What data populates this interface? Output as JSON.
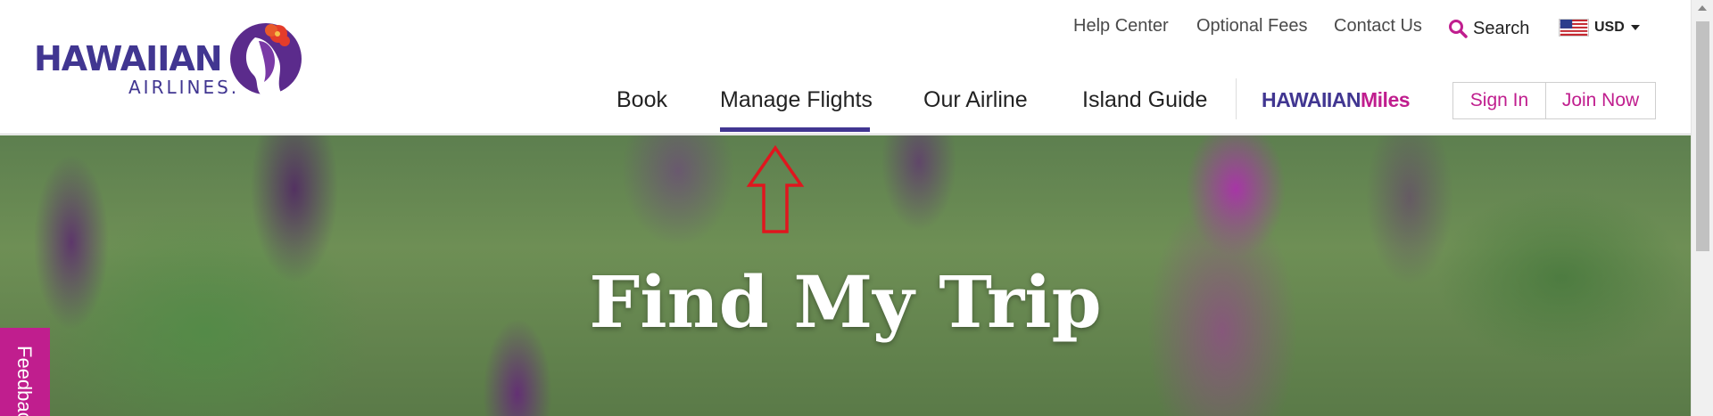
{
  "brand": {
    "logo_main": "HAWAIIAN",
    "logo_sub": "AIRLINES.",
    "primary_color": "#413691",
    "accent_color": "#c01e8e"
  },
  "utility_nav": {
    "help_center": "Help Center",
    "optional_fees": "Optional Fees",
    "contact_us": "Contact Us",
    "search": "Search",
    "currency": "USD"
  },
  "main_nav": {
    "items": [
      "Book",
      "Manage Flights",
      "Our Airline",
      "Island Guide"
    ],
    "active_item": "Manage Flights",
    "miles_part1": "HAWAIIAN",
    "miles_part2": "Miles",
    "sign_in": "Sign In",
    "join_now": "Join Now"
  },
  "hero": {
    "title": "Find My Trip"
  },
  "feedback_tab": {
    "label": "Feedback"
  },
  "icons": [
    "search-icon",
    "us-flag-icon",
    "caret-down-icon",
    "hawaiian-logo-mark-icon",
    "annotation-arrow-up-icon"
  ]
}
